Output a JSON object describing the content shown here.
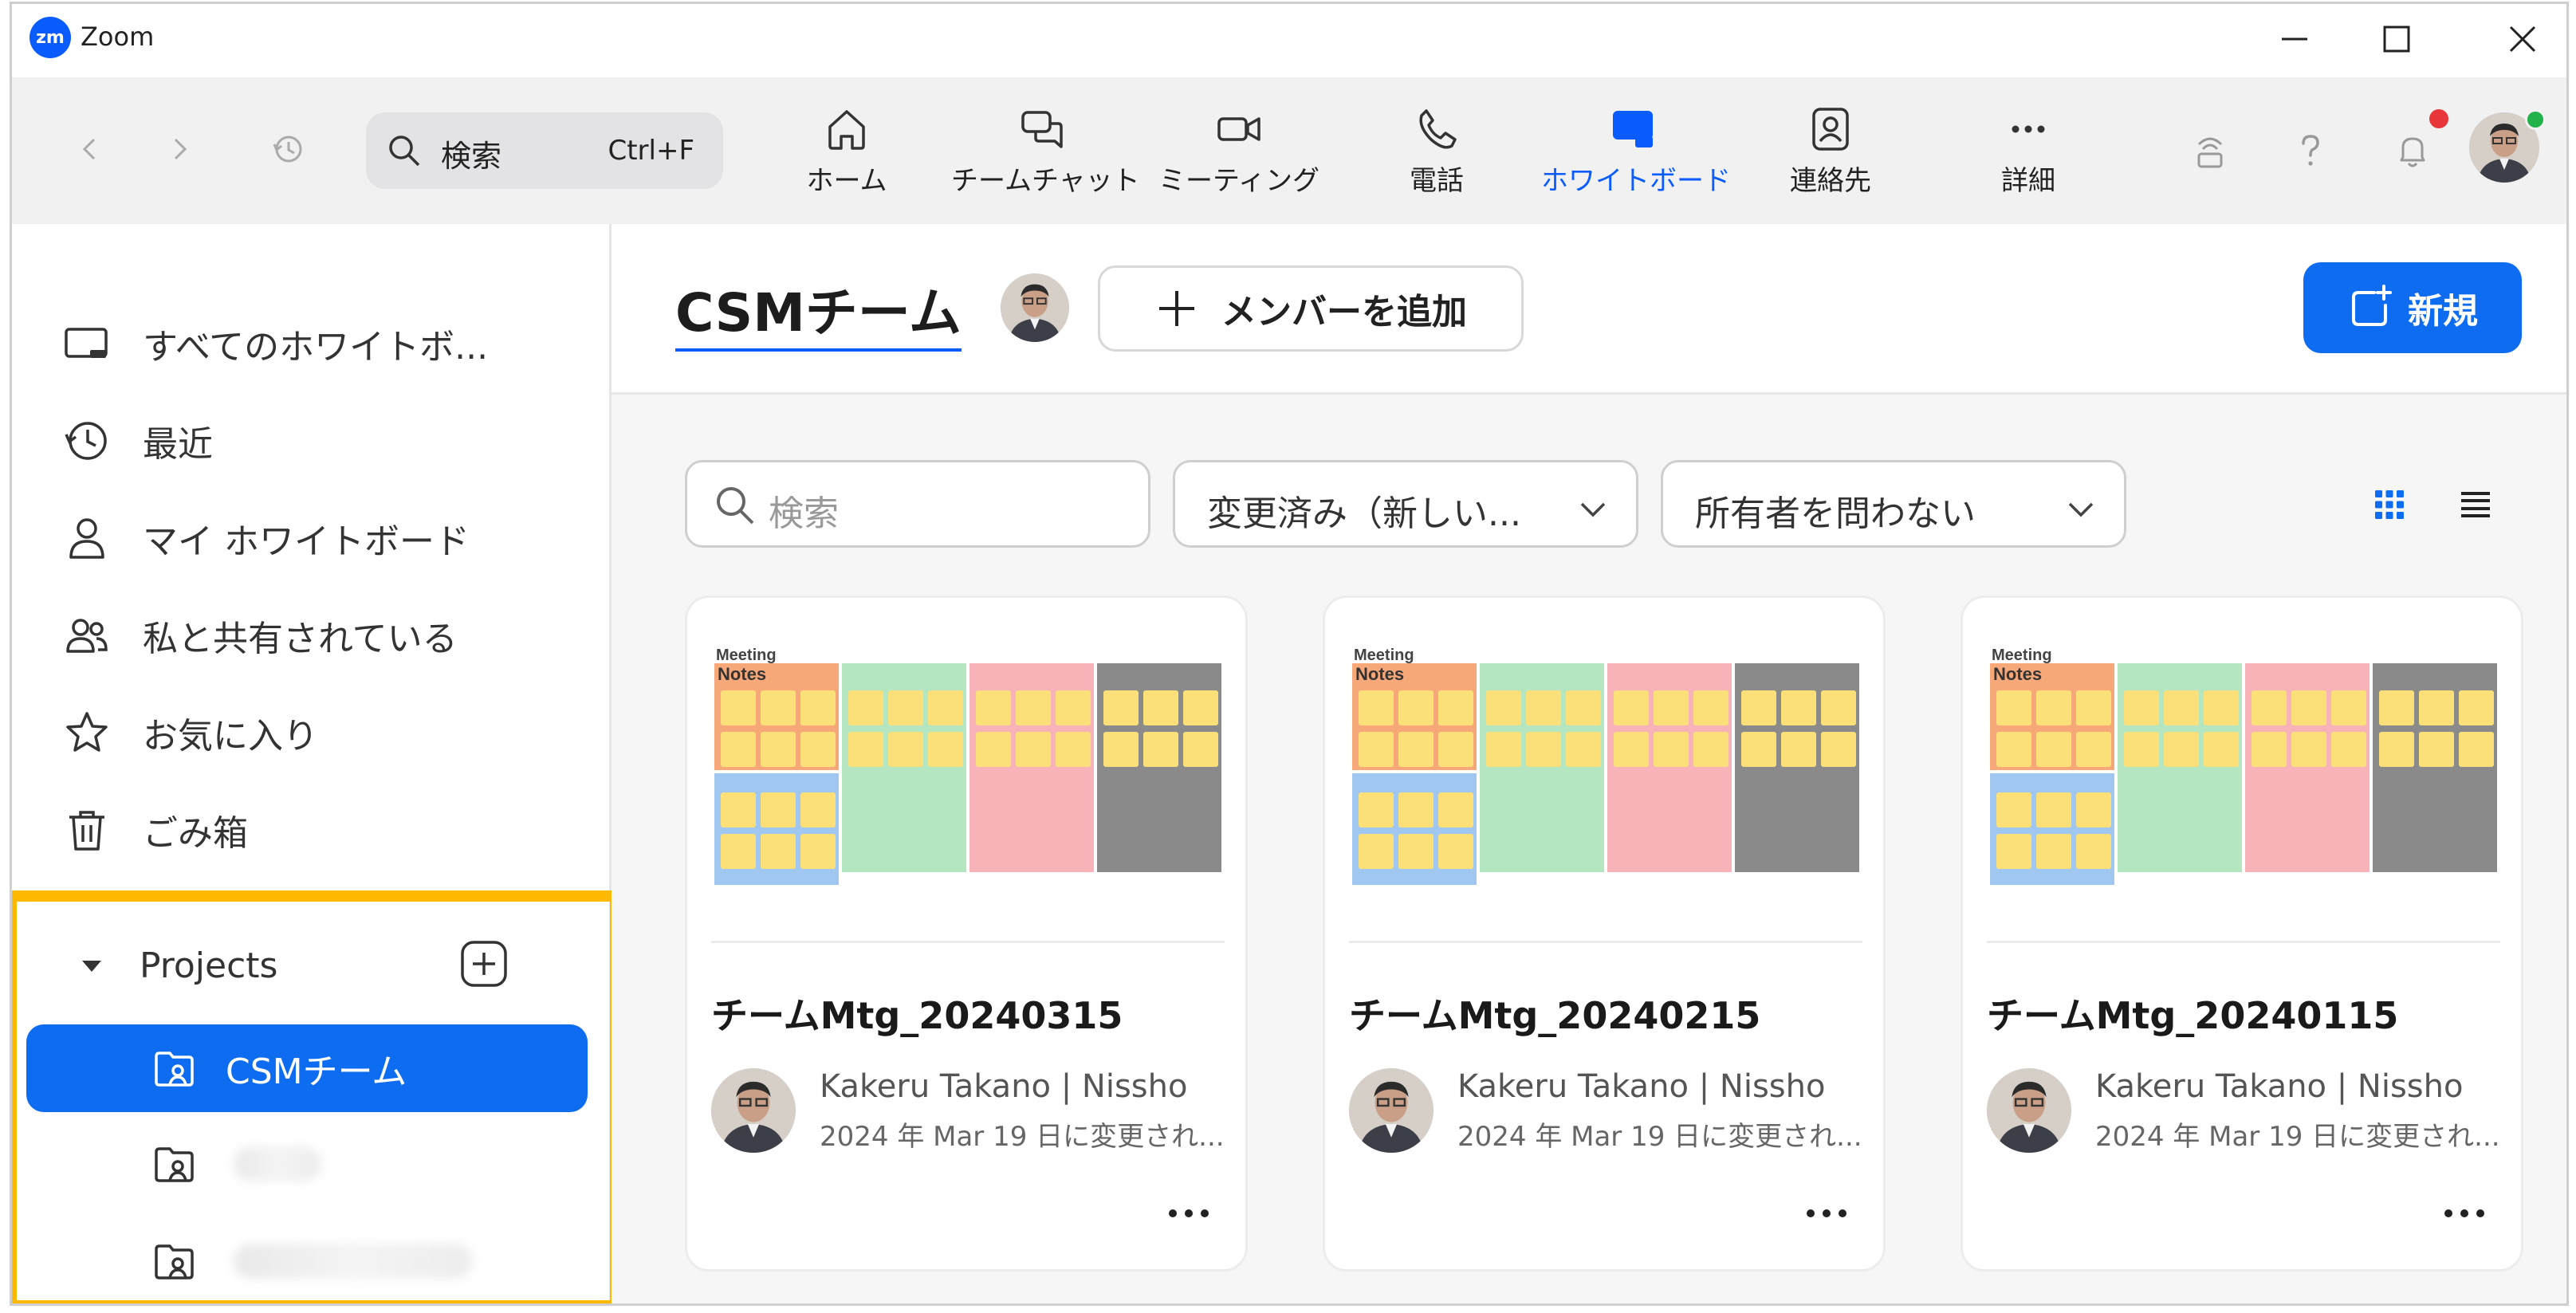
{
  "window": {
    "app_logo": "zm",
    "app_name": "Zoom"
  },
  "toolbar": {
    "search_label": "検索",
    "search_shortcut": "Ctrl+F",
    "tabs": [
      {
        "label": "ホーム",
        "icon": "home-icon"
      },
      {
        "label": "チームチャット",
        "icon": "chat-icon"
      },
      {
        "label": "ミーティング",
        "icon": "video-icon"
      },
      {
        "label": "電話",
        "icon": "phone-icon"
      },
      {
        "label": "ホワイトボード",
        "icon": "whiteboard-icon",
        "active": true
      },
      {
        "label": "連絡先",
        "icon": "contacts-icon"
      },
      {
        "label": "詳細",
        "icon": "more-icon"
      }
    ]
  },
  "sidebar": {
    "items": [
      {
        "label": "すべてのホワイトボ...",
        "icon": "whiteboard-outline-icon"
      },
      {
        "label": "最近",
        "icon": "clock-icon"
      },
      {
        "label": "マイ ホワイトボード",
        "icon": "person-icon"
      },
      {
        "label": "私と共有されている",
        "icon": "people-icon"
      },
      {
        "label": "お気に入り",
        "icon": "star-icon"
      },
      {
        "label": "ごみ箱",
        "icon": "trash-icon"
      }
    ],
    "projects": {
      "label": "Projects",
      "items": [
        {
          "label": "CSMチーム",
          "active": true
        }
      ]
    }
  },
  "main": {
    "title": "CSMチーム",
    "add_member_label": "メンバーを追加",
    "new_label": "新規",
    "filters": {
      "search_placeholder": "検索",
      "sort": "変更済み（新しい...",
      "owner": "所有者を問わない"
    },
    "cards": [
      {
        "title": "チームMtg_20240315",
        "owner": "Kakeru Takano | Nissho",
        "date": "2024 年 Mar 19 日に変更され...",
        "thumb_heading_1": "Meeting",
        "thumb_heading_2": "Notes"
      },
      {
        "title": "チームMtg_20240215",
        "owner": "Kakeru Takano | Nissho",
        "date": "2024 年 Mar 19 日に変更され...",
        "thumb_heading_1": "Meeting",
        "thumb_heading_2": "Notes"
      },
      {
        "title": "チームMtg_20240115",
        "owner": "Kakeru Takano | Nissho",
        "date": "2024 年 Mar 19 日に変更され...",
        "thumb_heading_1": "Meeting",
        "thumb_heading_2": "Notes"
      }
    ]
  },
  "colors": {
    "accent": "#0e6cf0",
    "highlight_frame": "#ffb900",
    "notification": "#e8363b",
    "presence": "#22b24c"
  }
}
